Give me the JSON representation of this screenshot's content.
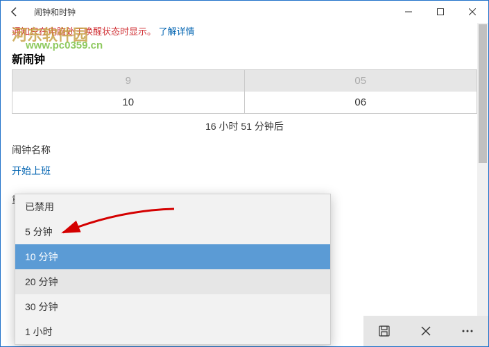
{
  "titlebar": {
    "title": "闹钟和时钟"
  },
  "notice": {
    "red_text": "通知只在电脑处于唤醒状态时显示。",
    "link_text": "了解详情"
  },
  "watermark": {
    "line1": "河东软件园",
    "line2": "www.pc0359.cn"
  },
  "heading": "新闹钟",
  "picker": {
    "hour_prev": "9",
    "hour": "10",
    "min_prev": "05",
    "min": "06"
  },
  "countdown": "16 小时 51 分钟后",
  "name_section": {
    "label": "闹钟名称",
    "value": "开始上班"
  },
  "repeat_label": "重复",
  "dropdown": {
    "items": [
      {
        "label": "已禁用",
        "sel": false,
        "alt": false
      },
      {
        "label": "5 分钟",
        "sel": false,
        "alt": false
      },
      {
        "label": "10 分钟",
        "sel": true,
        "alt": false
      },
      {
        "label": "20 分钟",
        "sel": false,
        "alt": true
      },
      {
        "label": "30 分钟",
        "sel": false,
        "alt": false
      },
      {
        "label": "1 小时",
        "sel": false,
        "alt": false
      }
    ]
  }
}
